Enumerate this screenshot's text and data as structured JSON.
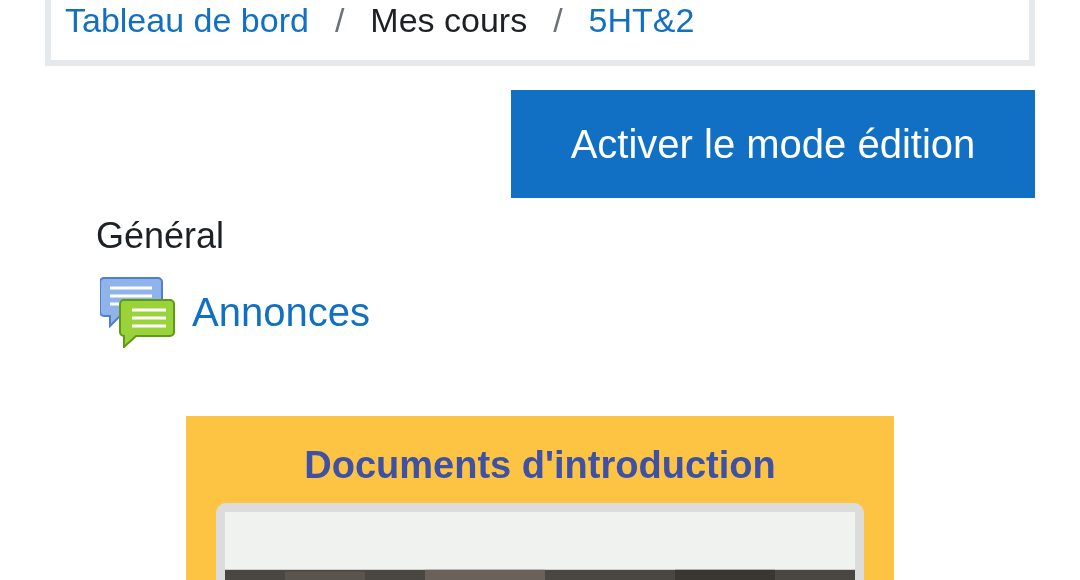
{
  "breadcrumb": [
    {
      "label": "Tableau de bord",
      "kind": "link"
    },
    {
      "label": "Mes cours",
      "kind": "text"
    },
    {
      "label": "5HT&2",
      "kind": "link"
    }
  ],
  "separator": "/",
  "edit_button": "Activer le mode édition",
  "section": {
    "title": "Général",
    "activities": [
      {
        "label": "Annonces",
        "kind": "forum"
      }
    ]
  },
  "banner": {
    "title": "Documents d'introduction"
  }
}
